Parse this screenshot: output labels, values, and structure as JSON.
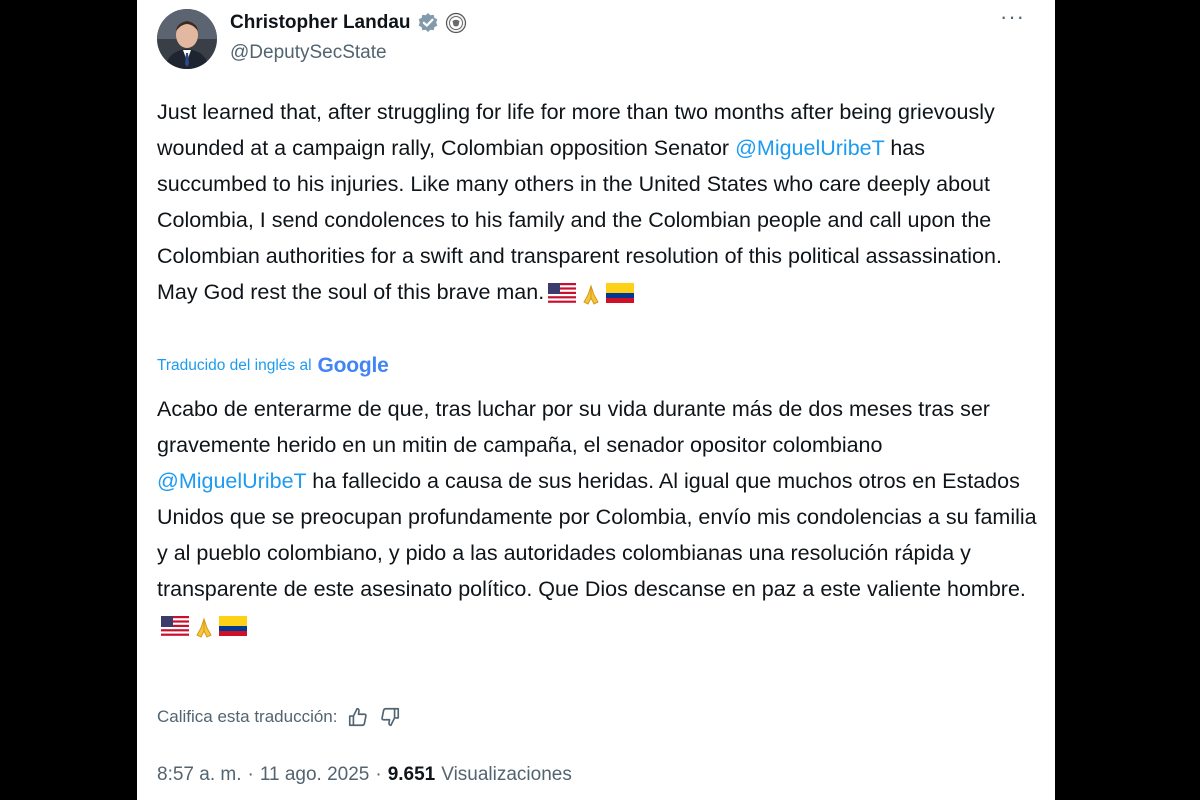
{
  "author": {
    "display_name": "Christopher Landau",
    "handle": "@DeputySecState",
    "avatar_icon": "profile-photo",
    "verified_icon": "verified-badge-icon",
    "affiliate_icon": "government-affiliation-icon"
  },
  "menu": {
    "more_icon": "more-options-icon",
    "more_label": "···"
  },
  "original": {
    "segment_1": "Just learned that, after struggling for life for more than two months after being grievously wounded at a campaign rally, Colombian opposition Senator ",
    "mention": "@MiguelUribeT",
    "segment_2": " has succumbed to his injuries. Like many others in the United States who care deeply about Colombia, I send condolences to his family and the Colombian people and call upon the Colombian authorities for a swift and transparent resolution of this political assassination. May God rest the soul of this brave man.",
    "emojis": [
      "us-flag-emoji",
      "folded-hands-emoji",
      "colombia-flag-emoji"
    ]
  },
  "translation": {
    "label": "Traducido del inglés al",
    "provider": "Google",
    "segment_1": "Acabo de enterarme de que, tras luchar por su vida durante más de dos meses tras ser gravemente herido en un mitin de campaña, el senador opositor colombiano ",
    "mention": "@MiguelUribeT",
    "segment_2": " ha fallecido a causa de sus heridas. Al igual que muchos otros en Estados Unidos que se preocupan profundamente por Colombia, envío mis condolencias a su familia y al pueblo colombiano, y pido a las autoridades colombianas una resolución rápida y transparente de este asesinato político. Que Dios descanse en paz a este valiente hombre.",
    "emojis": [
      "us-flag-emoji",
      "folded-hands-emoji",
      "colombia-flag-emoji"
    ]
  },
  "rating": {
    "label": "Califica esta traducción:",
    "thumbs_up_icon": "thumbs-up-icon",
    "thumbs_down_icon": "thumbs-down-icon"
  },
  "meta": {
    "time": "8:57 a. m.",
    "separator": "·",
    "date": "11 ago. 2025",
    "views_count": "9.651",
    "views_label": "Visualizaciones"
  },
  "colors": {
    "link": "#1d9bf0",
    "secondary_text": "#536471",
    "primary_text": "#0f1419",
    "backdrop": "#000000",
    "card": "#ffffff"
  }
}
